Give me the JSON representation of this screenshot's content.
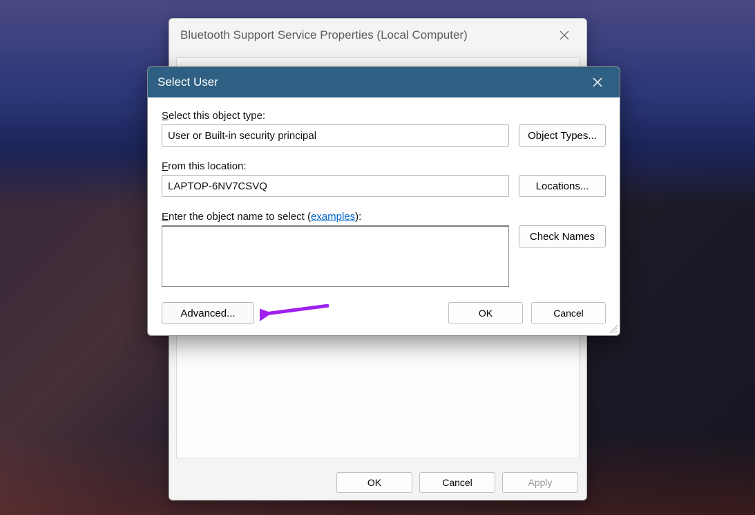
{
  "bg_dialog": {
    "title": "Bluetooth Support Service Properties (Local Computer)",
    "buttons": {
      "ok": "OK",
      "cancel": "Cancel",
      "apply": "Apply"
    }
  },
  "fg_dialog": {
    "title": "Select User",
    "object_type_label": "Select this object type:",
    "object_type_value": "User or Built-in security principal",
    "object_types_btn": "Object Types...",
    "location_label": "From this location:",
    "location_value": "LAPTOP-6NV7CSVQ",
    "locations_btn": "Locations...",
    "enter_name_prefix": "Enter the object name to select (",
    "enter_name_link": "examples",
    "enter_name_suffix": "):",
    "name_value": "",
    "check_names_btn": "Check Names",
    "advanced_btn": "Advanced...",
    "ok_btn": "OK",
    "cancel_btn": "Cancel"
  },
  "annotation": {
    "arrow_color": "#a020f0"
  }
}
